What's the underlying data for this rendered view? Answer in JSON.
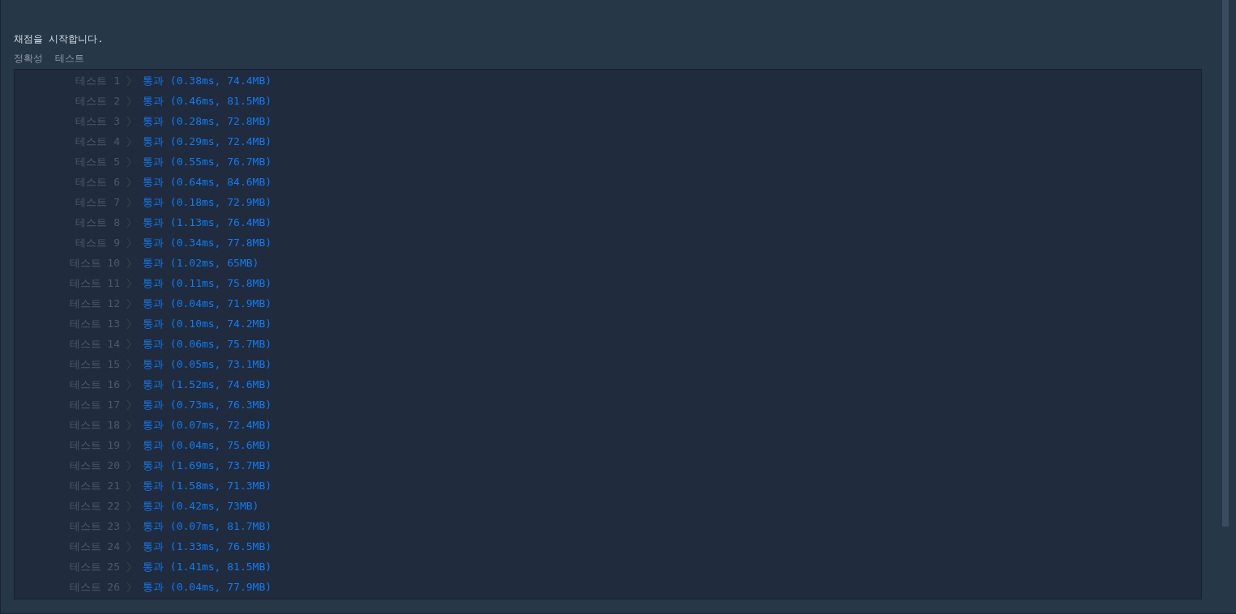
{
  "message": "채점을 시작합니다.",
  "tabs": [
    {
      "label": "정확성"
    },
    {
      "label": "테스트"
    }
  ],
  "results": [
    {
      "label": "테스트 1",
      "result": "통과 (0.38ms, 74.4MB)"
    },
    {
      "label": "테스트 2",
      "result": "통과 (0.46ms, 81.5MB)"
    },
    {
      "label": "테스트 3",
      "result": "통과 (0.28ms, 72.8MB)"
    },
    {
      "label": "테스트 4",
      "result": "통과 (0.29ms, 72.4MB)"
    },
    {
      "label": "테스트 5",
      "result": "통과 (0.55ms, 76.7MB)"
    },
    {
      "label": "테스트 6",
      "result": "통과 (0.64ms, 84.6MB)"
    },
    {
      "label": "테스트 7",
      "result": "통과 (0.18ms, 72.9MB)"
    },
    {
      "label": "테스트 8",
      "result": "통과 (1.13ms, 76.4MB)"
    },
    {
      "label": "테스트 9",
      "result": "통과 (0.34ms, 77.8MB)"
    },
    {
      "label": "테스트 10",
      "result": "통과 (1.02ms, 65MB)"
    },
    {
      "label": "테스트 11",
      "result": "통과 (0.11ms, 75.8MB)"
    },
    {
      "label": "테스트 12",
      "result": "통과 (0.04ms, 71.9MB)"
    },
    {
      "label": "테스트 13",
      "result": "통과 (0.10ms, 74.2MB)"
    },
    {
      "label": "테스트 14",
      "result": "통과 (0.06ms, 75.7MB)"
    },
    {
      "label": "테스트 15",
      "result": "통과 (0.05ms, 73.1MB)"
    },
    {
      "label": "테스트 16",
      "result": "통과 (1.52ms, 74.6MB)"
    },
    {
      "label": "테스트 17",
      "result": "통과 (0.73ms, 76.3MB)"
    },
    {
      "label": "테스트 18",
      "result": "통과 (0.07ms, 72.4MB)"
    },
    {
      "label": "테스트 19",
      "result": "통과 (0.04ms, 75.6MB)"
    },
    {
      "label": "테스트 20",
      "result": "통과 (1.69ms, 73.7MB)"
    },
    {
      "label": "테스트 21",
      "result": "통과 (1.58ms, 71.3MB)"
    },
    {
      "label": "테스트 22",
      "result": "통과 (0.42ms, 73MB)"
    },
    {
      "label": "테스트 23",
      "result": "통과 (0.07ms, 81.7MB)"
    },
    {
      "label": "테스트 24",
      "result": "통과 (1.33ms, 76.5MB)"
    },
    {
      "label": "테스트 25",
      "result": "통과 (1.41ms, 81.5MB)"
    },
    {
      "label": "테스트 26",
      "result": "통과 (0.04ms, 77.9MB)"
    }
  ]
}
